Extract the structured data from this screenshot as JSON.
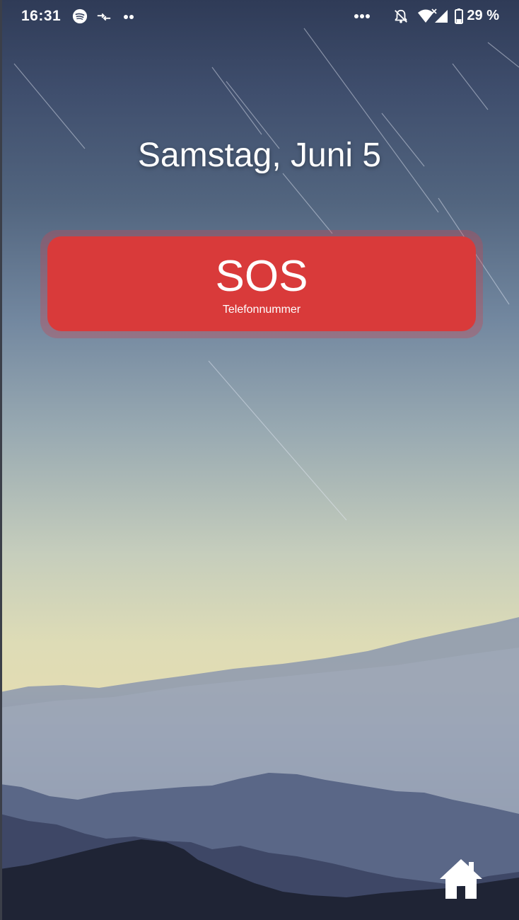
{
  "status_bar": {
    "time": "16:31",
    "battery_text": "29 %",
    "icons_left": [
      "spotify-icon",
      "data-transfer-icon",
      "more-notifications-icon"
    ],
    "icons_right": [
      "more-icon",
      "notifications-off-icon",
      "wifi-icon",
      "signal-icon",
      "battery-icon"
    ]
  },
  "lockscreen": {
    "date": "Samstag, Juni 5"
  },
  "sos": {
    "title": "SOS",
    "subtitle": "Telefonnummer",
    "color": "#d93a3a"
  },
  "home": {
    "icon": "home-icon"
  }
}
